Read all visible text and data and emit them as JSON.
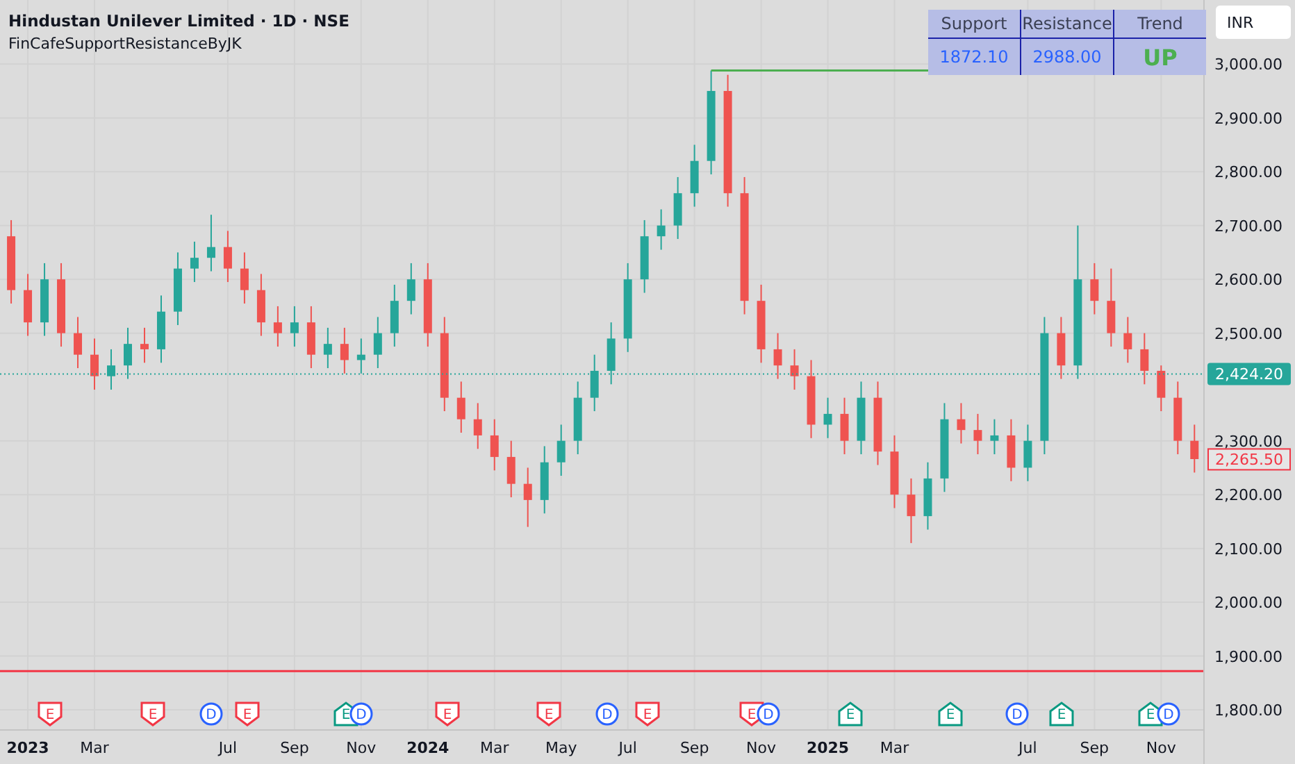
{
  "header": {
    "title": "Hindustan Unilever Limited · 1D · NSE",
    "indicator": "FinCafeSupportResistanceByJK"
  },
  "currency_button": "INR",
  "sr_table": {
    "columns": [
      "Support",
      "Resistance",
      "Trend"
    ],
    "values": [
      "1872.10",
      "2988.00",
      "UP"
    ]
  },
  "chart": {
    "chart_data": {
      "type": "candlestick",
      "categories": [
        null,
        "2023",
        null,
        null,
        null,
        "Mar",
        null,
        null,
        null,
        null,
        null,
        null,
        null,
        "Jul",
        null,
        null,
        null,
        "Sep",
        null,
        null,
        null,
        "Nov",
        null,
        null,
        null,
        "2024",
        null,
        null,
        null,
        "Mar",
        null,
        null,
        null,
        "May",
        null,
        null,
        null,
        "Jul",
        null,
        null,
        null,
        "Sep",
        null,
        null,
        null,
        "Nov",
        null,
        null,
        null,
        "2025",
        null,
        null,
        null,
        "Mar",
        null,
        null,
        null,
        null,
        null,
        null,
        null,
        "Jul",
        null,
        null,
        null,
        "Sep",
        null,
        null,
        null,
        "Nov",
        null,
        null
      ],
      "ohlc": [
        [
          2680,
          2710,
          2555,
          2580
        ],
        [
          2580,
          2610,
          2495,
          2520
        ],
        [
          2520,
          2630,
          2495,
          2600
        ],
        [
          2600,
          2630,
          2475,
          2500
        ],
        [
          2500,
          2530,
          2435,
          2460
        ],
        [
          2460,
          2490,
          2395,
          2420
        ],
        [
          2420,
          2470,
          2395,
          2440
        ],
        [
          2440,
          2510,
          2415,
          2480
        ],
        [
          2480,
          2510,
          2445,
          2470
        ],
        [
          2470,
          2570,
          2445,
          2540
        ],
        [
          2540,
          2650,
          2515,
          2620
        ],
        [
          2620,
          2670,
          2595,
          2640
        ],
        [
          2640,
          2720,
          2615,
          2660
        ],
        [
          2660,
          2690,
          2595,
          2620
        ],
        [
          2620,
          2650,
          2555,
          2580
        ],
        [
          2580,
          2610,
          2495,
          2520
        ],
        [
          2520,
          2550,
          2475,
          2500
        ],
        [
          2500,
          2550,
          2475,
          2520
        ],
        [
          2520,
          2550,
          2435,
          2460
        ],
        [
          2460,
          2510,
          2435,
          2480
        ],
        [
          2480,
          2510,
          2425,
          2450
        ],
        [
          2450,
          2490,
          2425,
          2460
        ],
        [
          2460,
          2530,
          2435,
          2500
        ],
        [
          2500,
          2590,
          2475,
          2560
        ],
        [
          2560,
          2630,
          2535,
          2600
        ],
        [
          2600,
          2630,
          2475,
          2500
        ],
        [
          2500,
          2530,
          2355,
          2380
        ],
        [
          2380,
          2410,
          2315,
          2340
        ],
        [
          2340,
          2370,
          2285,
          2310
        ],
        [
          2310,
          2340,
          2245,
          2270
        ],
        [
          2270,
          2300,
          2195,
          2220
        ],
        [
          2220,
          2250,
          2140,
          2190
        ],
        [
          2190,
          2290,
          2165,
          2260
        ],
        [
          2260,
          2330,
          2235,
          2300
        ],
        [
          2300,
          2410,
          2275,
          2380
        ],
        [
          2380,
          2460,
          2355,
          2430
        ],
        [
          2430,
          2520,
          2405,
          2490
        ],
        [
          2490,
          2630,
          2465,
          2600
        ],
        [
          2600,
          2710,
          2575,
          2680
        ],
        [
          2680,
          2730,
          2655,
          2700
        ],
        [
          2700,
          2790,
          2675,
          2760
        ],
        [
          2760,
          2850,
          2735,
          2820
        ],
        [
          2820,
          2988,
          2795,
          2950
        ],
        [
          2950,
          2980,
          2735,
          2760
        ],
        [
          2760,
          2790,
          2535,
          2560
        ],
        [
          2560,
          2590,
          2445,
          2470
        ],
        [
          2470,
          2500,
          2415,
          2440
        ],
        [
          2440,
          2470,
          2395,
          2420
        ],
        [
          2420,
          2450,
          2305,
          2330
        ],
        [
          2330,
          2380,
          2305,
          2350
        ],
        [
          2350,
          2380,
          2275,
          2300
        ],
        [
          2300,
          2410,
          2275,
          2380
        ],
        [
          2380,
          2410,
          2255,
          2280
        ],
        [
          2280,
          2310,
          2175,
          2200
        ],
        [
          2200,
          2230,
          2110,
          2160
        ],
        [
          2160,
          2260,
          2135,
          2230
        ],
        [
          2230,
          2370,
          2205,
          2340
        ],
        [
          2340,
          2370,
          2295,
          2320
        ],
        [
          2320,
          2350,
          2275,
          2300
        ],
        [
          2300,
          2340,
          2275,
          2310
        ],
        [
          2310,
          2340,
          2225,
          2250
        ],
        [
          2250,
          2330,
          2225,
          2300
        ],
        [
          2300,
          2530,
          2275,
          2500
        ],
        [
          2500,
          2530,
          2415,
          2440
        ],
        [
          2440,
          2700,
          2415,
          2600
        ],
        [
          2600,
          2630,
          2535,
          2560
        ],
        [
          2560,
          2620,
          2475,
          2500
        ],
        [
          2500,
          2530,
          2445,
          2470
        ],
        [
          2470,
          2500,
          2405,
          2430
        ],
        [
          2430,
          2440,
          2355,
          2380
        ],
        [
          2380,
          2410,
          2275,
          2300
        ],
        [
          2300,
          2330,
          2241,
          2266
        ]
      ],
      "ylim": [
        1764,
        3119
      ],
      "grid": true,
      "ref_lines": [
        {
          "axis": "y",
          "value": 1872.1,
          "color": "#f23645"
        },
        {
          "axis": "y",
          "value": 2988,
          "color": "#4caf50"
        },
        {
          "axis": "y",
          "value": 2424.2,
          "color": "#26a69a"
        }
      ],
      "yticks": [
        {
          "value": 1800,
          "label": "1,800.00"
        },
        {
          "value": 1900,
          "label": "1,900.00"
        },
        {
          "value": 2000,
          "label": "2,000.00"
        },
        {
          "value": 2100,
          "label": "2,100.00"
        },
        {
          "value": 2200,
          "label": "2,200.00"
        },
        {
          "value": 2300,
          "label": "2,300.00"
        },
        {
          "value": 2500,
          "label": "2,500.00"
        },
        {
          "value": 2600,
          "label": "2,600.00"
        },
        {
          "value": 2700,
          "label": "2,700.00"
        },
        {
          "value": 2800,
          "label": "2,800.00"
        },
        {
          "value": 2900,
          "label": "2,900.00"
        },
        {
          "value": 3000,
          "label": "3,000.00"
        }
      ]
    },
    "price_badges": [
      {
        "kind": "last",
        "label": "2,424.20",
        "color": "#26a69a"
      },
      {
        "kind": "close",
        "label": "2,265.50",
        "color": "#f23645"
      }
    ],
    "events": [
      {
        "kind": "earnings",
        "letter": "E",
        "color": "#f23645",
        "positive": false
      },
      {
        "kind": "earnings",
        "letter": "E",
        "color": "#f23645",
        "positive": false
      },
      {
        "kind": "dividend",
        "letter": "D",
        "color": "#2962ff"
      },
      {
        "kind": "earnings",
        "letter": "E",
        "color": "#f23645",
        "positive": false
      },
      {
        "kind": "earnings",
        "letter": "E",
        "color": "#089981",
        "positive": true
      },
      {
        "kind": "dividend",
        "letter": "D",
        "color": "#2962ff"
      },
      {
        "kind": "earnings",
        "letter": "E",
        "color": "#f23645",
        "positive": false
      },
      {
        "kind": "earnings",
        "letter": "E",
        "color": "#f23645",
        "positive": false
      },
      {
        "kind": "dividend",
        "letter": "D",
        "color": "#2962ff"
      },
      {
        "kind": "earnings",
        "letter": "E",
        "color": "#f23645",
        "positive": false
      },
      {
        "kind": "earnings",
        "letter": "E",
        "color": "#f23645",
        "positive": false
      },
      {
        "kind": "dividend",
        "letter": "D",
        "color": "#2962ff"
      },
      {
        "kind": "earnings",
        "letter": "E",
        "color": "#089981",
        "positive": true
      },
      {
        "kind": "earnings",
        "letter": "E",
        "color": "#089981",
        "positive": true
      },
      {
        "kind": "dividend",
        "letter": "D",
        "color": "#2962ff"
      },
      {
        "kind": "earnings",
        "letter": "E",
        "color": "#089981",
        "positive": true
      },
      {
        "kind": "earnings",
        "letter": "E",
        "color": "#089981",
        "positive": true
      },
      {
        "kind": "dividend",
        "letter": "D",
        "color": "#2962ff"
      }
    ]
  }
}
